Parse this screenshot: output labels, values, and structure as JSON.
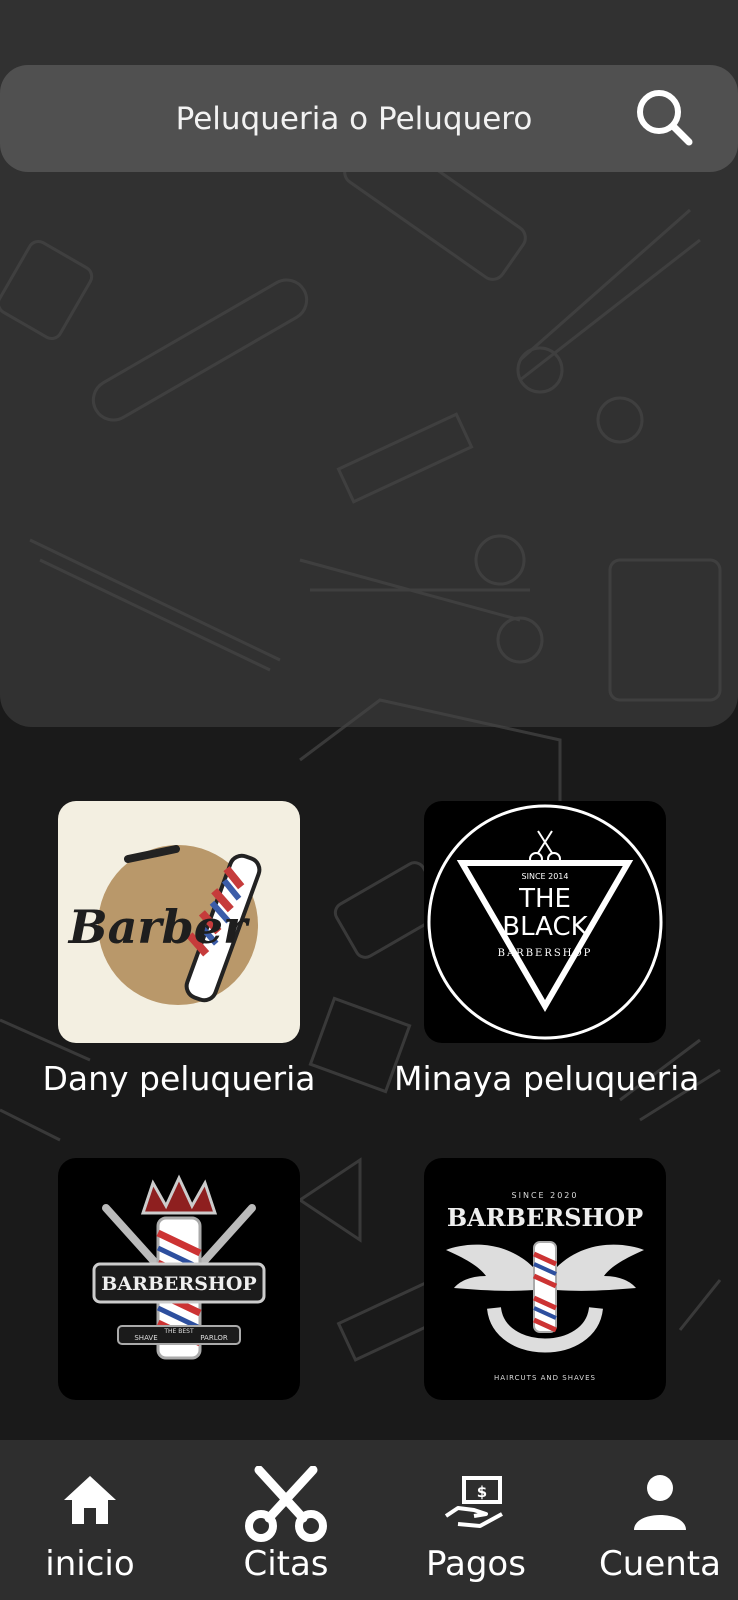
{
  "search": {
    "placeholder": "Peluqueria o Peluquero"
  },
  "shops": [
    {
      "name": "Dany peluqueria",
      "logo_text": "Barber"
    },
    {
      "name": "Minaya peluqueria",
      "logo_text": [
        "SINCE 2014",
        "THE",
        "BLACK",
        "BARBERSHOP"
      ]
    },
    {
      "name": "",
      "logo_text": [
        "BARBERSHOP",
        "THE BEST",
        "SHAVE",
        "PARLOR"
      ]
    },
    {
      "name": "",
      "logo_text": [
        "SINCE 2020",
        "BARBERSHOP",
        "HAIRCUTS AND SHAVES"
      ]
    }
  ],
  "nav": {
    "items": [
      {
        "label": "inicio",
        "icon": "home-icon"
      },
      {
        "label": "Citas",
        "icon": "scissors-icon"
      },
      {
        "label": "Pagos",
        "icon": "payment-icon"
      },
      {
        "label": "Cuenta",
        "icon": "user-icon"
      }
    ]
  },
  "colors": {
    "background": "#1a1a1a",
    "panel": "#3a3a3a",
    "search_bar": "#505050",
    "nav_bar": "#2e2e2e",
    "text": "#ffffff"
  }
}
